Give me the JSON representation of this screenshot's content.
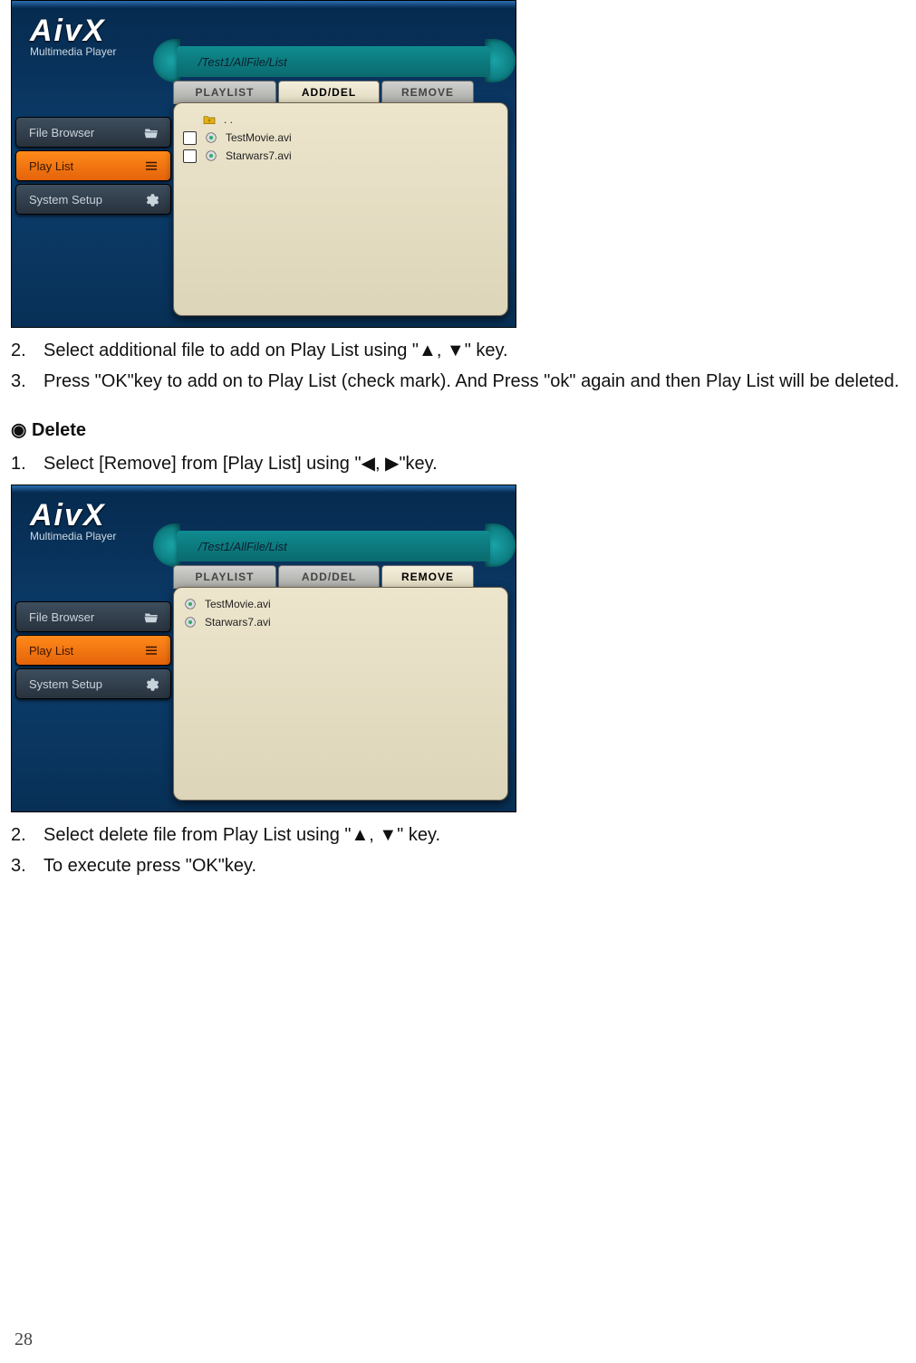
{
  "page_number": "28",
  "screenshot_common": {
    "brand": "AivX",
    "subtitle": "Multimedia Player",
    "breadcrumb": "/Test1/AllFile/List",
    "nav": {
      "file_browser": "File Browser",
      "play_list": "Play List",
      "system_setup": "System Setup"
    },
    "tabs": {
      "playlist": "PLAYLIST",
      "adddel": "ADD/DEL",
      "remove": "REMOVE"
    }
  },
  "shot1": {
    "active_tab": "adddel",
    "rows": {
      "up": ". .",
      "file1": "TestMovie.avi",
      "file2": "Starwars7.avi"
    }
  },
  "shot2": {
    "active_tab": "remove",
    "rows": {
      "file1": "TestMovie.avi",
      "file2": "Starwars7.avi"
    }
  },
  "text": {
    "s1_step2": "Select additional file to add on Play List using \"▲, ▼\" key.",
    "s1_step3": "Press \"OK\"key to add on to Play List (check mark). And Press \"ok\" again and then Play List will be deleted.",
    "delete_heading": "◉ Delete",
    "d_step1": "Select [Remove] from [Play List] using \"◀, ▶\"key.",
    "d_step2": "Select delete file from Play List using \"▲, ▼\" key.",
    "d_step3": "To execute press \"OK\"key."
  }
}
